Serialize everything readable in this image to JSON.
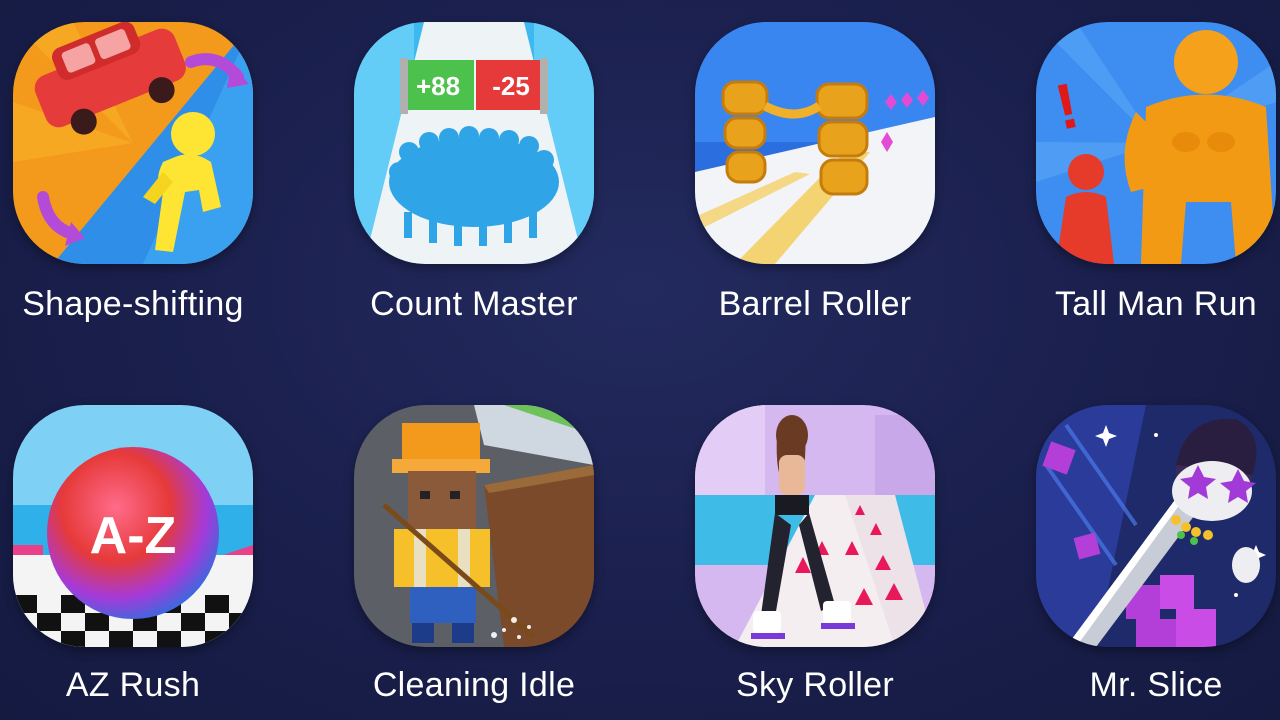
{
  "apps": [
    {
      "name": "Shape-shifting",
      "icon": "shape-shifting-icon",
      "icon_text": ""
    },
    {
      "name": "Count Master",
      "icon": "count-master-icon",
      "icon_text": [
        "+88",
        "-25"
      ]
    },
    {
      "name": "Barrel Roller",
      "icon": "barrel-roller-icon",
      "icon_text": ""
    },
    {
      "name": "Tall Man Run",
      "icon": "tall-man-run-icon",
      "icon_text": "!"
    },
    {
      "name": "AZ Rush",
      "icon": "az-rush-icon",
      "icon_text": "A-Z"
    },
    {
      "name": "Cleaning Idle",
      "icon": "cleaning-idle-icon",
      "icon_text": ""
    },
    {
      "name": "Sky Roller",
      "icon": "sky-roller-icon",
      "icon_text": ""
    },
    {
      "name": "Mr. Slice",
      "icon": "mr-slice-icon",
      "icon_text": ""
    }
  ],
  "colors": {
    "background": "#1a1f4c",
    "label": "#ffffff"
  }
}
